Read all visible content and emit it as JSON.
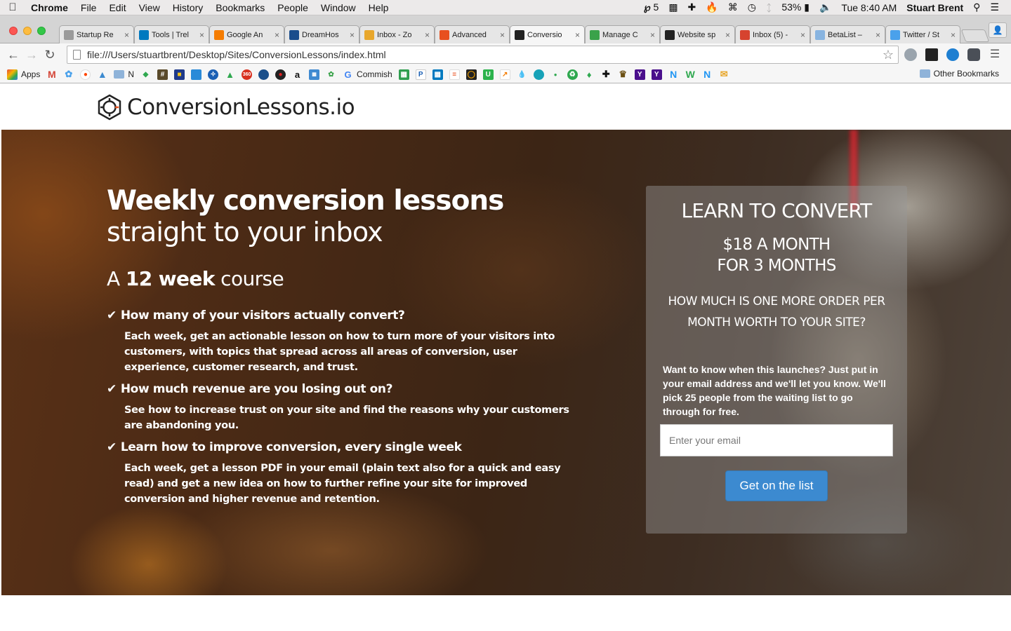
{
  "menubar": {
    "app": "Chrome",
    "items": [
      "File",
      "Edit",
      "View",
      "History",
      "Bookmarks",
      "People",
      "Window",
      "Help"
    ],
    "status": {
      "adobe": "5",
      "battery": "53%",
      "clock": "Tue 8:40 AM",
      "user": "Stuart Brent"
    }
  },
  "tabs": [
    {
      "title": "Startup Re",
      "color": "#9a9a9a"
    },
    {
      "title": "Tools | Trel",
      "color": "#0079bf"
    },
    {
      "title": "Google An",
      "color": "#f57c00"
    },
    {
      "title": "DreamHos",
      "color": "#1a4d8c"
    },
    {
      "title": "Inbox - Zo",
      "color": "#e8a72c"
    },
    {
      "title": "Advanced",
      "color": "#e8501f"
    },
    {
      "title": "Conversio",
      "color": "#222222",
      "active": true
    },
    {
      "title": "Manage C",
      "color": "#3aa24a"
    },
    {
      "title": "Website sp",
      "color": "#222222"
    },
    {
      "title": "Inbox (5) -",
      "color": "#d6432f"
    },
    {
      "title": "BetaList –",
      "color": "#88b4e0"
    },
    {
      "title": "Twitter / St",
      "color": "#4aa1eb"
    }
  ],
  "toolbar": {
    "url": "file:///Users/stuartbrent/Desktop/Sites/ConversionLessons/index.html"
  },
  "bookmarks": {
    "apps_label": "Apps",
    "n_label": "N",
    "commish_label": "Commish",
    "other_label": "Other Bookmarks"
  },
  "site": {
    "name": "ConversionLessons.io"
  },
  "hero": {
    "headline": "Weekly conversion lessons",
    "subheadline": "straight to your inbox",
    "course_prefix": "A ",
    "course_bold": "12 week",
    "course_suffix": " course",
    "features": [
      {
        "title": "How many of your visitors actually convert?",
        "desc": "Each week, get an actionable lesson on how to turn more of your visitors into customers, with topics that spread across all areas of conversion, user experience, customer research, and trust."
      },
      {
        "title": "How much revenue are you losing out on?",
        "desc": "See how to increase trust on your site and find the reasons why your customers are abandoning you."
      },
      {
        "title": "Learn how to improve conversion, every single week",
        "desc": "Each week, get a lesson PDF in your email (plain text also for a quick and easy read) and get a new idea on how to further refine your site for improved conversion and higher revenue and retention."
      }
    ]
  },
  "signup": {
    "title": "LEARN TO CONVERT",
    "price_line1": "$18 A MONTH",
    "price_line2": "FOR 3 MONTHS",
    "question": "HOW MUCH IS ONE MORE ORDER PER MONTH WORTH TO YOUR SITE?",
    "blurb": "Want to know when this launches? Just put in your email address and we'll let you know. We'll pick 25 people from the waiting list to go through for free.",
    "email_placeholder": "Enter your email",
    "email_value": "",
    "button_label": "Get on the list",
    "button_color": "#3c8ad0"
  }
}
